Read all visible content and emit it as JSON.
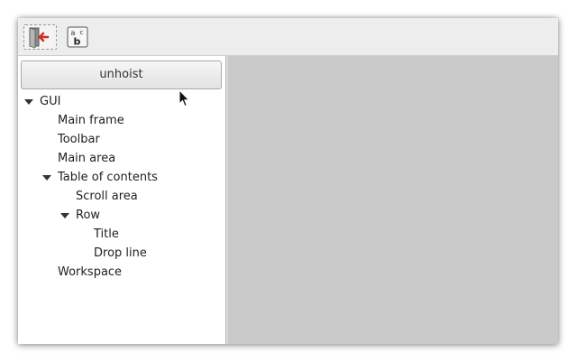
{
  "toolbar": {
    "buttons": [
      {
        "icon": "exit-door-icon"
      },
      {
        "icon": "abc-text-icon",
        "glyphs": [
          "a",
          "b",
          "c"
        ]
      }
    ]
  },
  "left_pane": {
    "unhoist_label": "unhoist",
    "tree": {
      "root": "GUI",
      "main_frame": "Main frame",
      "toolbar_node": "Toolbar",
      "main_area": "Main area",
      "table_of_contents": "Table of contents",
      "scroll_area": "Scroll area",
      "row": "Row",
      "title": "Title",
      "drop_line": "Drop line",
      "workspace": "Workspace"
    }
  },
  "colors": {
    "workspace_background": "#c9c9c9",
    "toolbar_background": "#ededed",
    "exit_icon_accent": "#d62b1f"
  }
}
